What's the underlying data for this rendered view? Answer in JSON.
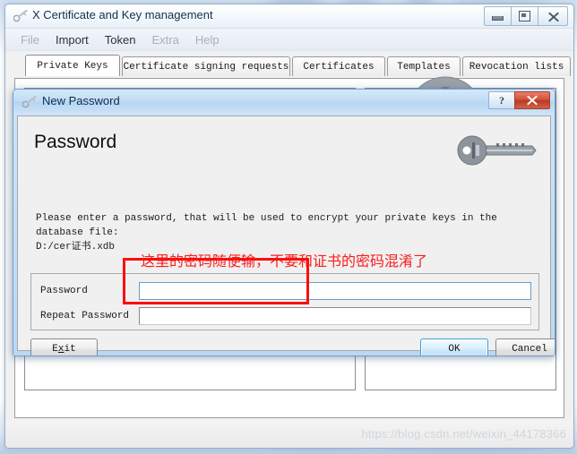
{
  "app": {
    "title": "X Certificate and Key management",
    "title_icon": "key-icon",
    "window_controls": {
      "minimize": "minimize-icon",
      "maximize": "maximize-icon",
      "close": "close-icon"
    },
    "menu": [
      {
        "label": "File",
        "enabled": false
      },
      {
        "label": "Import",
        "enabled": true
      },
      {
        "label": "Token",
        "enabled": true
      },
      {
        "label": "Extra",
        "enabled": false
      },
      {
        "label": "Help",
        "enabled": false
      }
    ],
    "tabs": [
      {
        "label": "Private Keys",
        "active": true
      },
      {
        "label": "Certificate signing requests",
        "active": false
      },
      {
        "label": "Certificates",
        "active": false
      },
      {
        "label": "Templates",
        "active": false
      },
      {
        "label": "Revocation lists",
        "active": false
      }
    ],
    "watermark": "https://blog.csdn.net/weixin_44178366"
  },
  "dialog": {
    "title": "New Password",
    "title_icon": "key-icon",
    "help_glyph": "?",
    "close_icon": "close-icon",
    "heading": "Password",
    "header_icon": "key-icon",
    "description_line1": "Please enter a password, that will be used to encrypt your private keys in the database file:",
    "description_line2": "D:/cer证书.xdb",
    "annotation_text": "这里的密码随便输，不要和证书的密码混淆了",
    "annotation_color": "#fb1d1d",
    "fields": [
      {
        "label": "Password",
        "value": "",
        "focused": true
      },
      {
        "label": "Repeat Password",
        "value": "",
        "focused": false
      }
    ],
    "buttons": {
      "exit": {
        "label": "Exit",
        "accelerator": "x"
      },
      "ok": {
        "label": "OK",
        "default": true
      },
      "cancel": {
        "label": "Cancel"
      }
    }
  },
  "colors": {
    "annotation_red": "#fb1d1d",
    "dialog_close_red": "#c2452c",
    "dialog_titlebar_blue": "#c2dcf4",
    "default_button_blue": "#3e9fd6"
  }
}
